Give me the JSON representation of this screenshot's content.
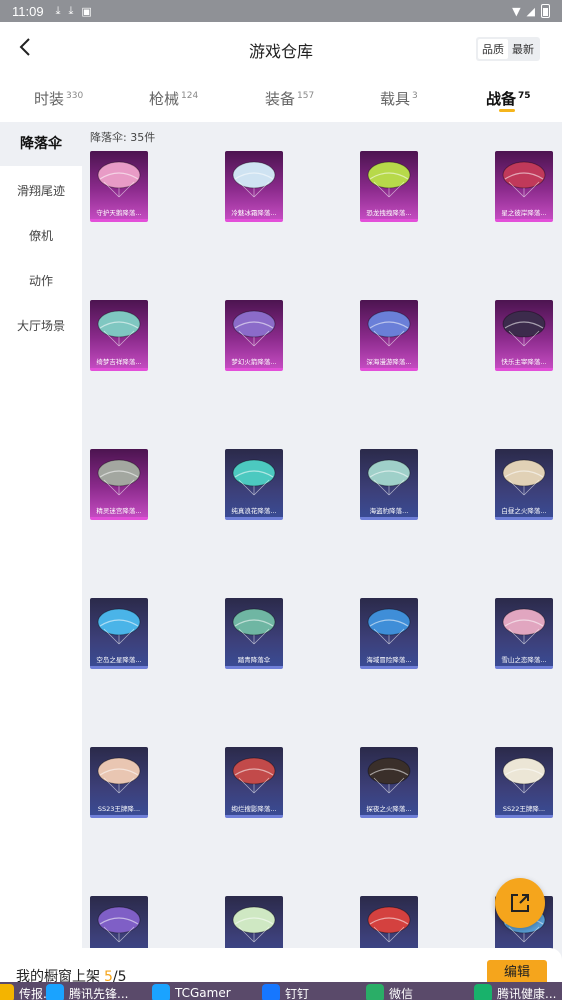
{
  "status": {
    "time": "11:09",
    "icons": [
      "download-icon",
      "download-icon",
      "app-icon"
    ],
    "wifi": "wifi-icon",
    "signal": "signal-icon",
    "battery": "battery-icon"
  },
  "header": {
    "title": "游戏仓库",
    "sort_options": [
      "品质",
      "最新"
    ],
    "sort_active": "品质"
  },
  "tabs": [
    {
      "label": "时装",
      "count": "330"
    },
    {
      "label": "枪械",
      "count": "124"
    },
    {
      "label": "装备",
      "count": "157"
    },
    {
      "label": "载具",
      "count": "3"
    },
    {
      "label": "战备",
      "count": "75"
    }
  ],
  "active_tab": "战备",
  "sidebar": [
    "降落伞",
    "滑翔尾迹",
    "僚机",
    "动作",
    "大厅场景"
  ],
  "sidebar_active": "降落伞",
  "count_label": "降落伞: 35件",
  "items": [
    {
      "name": "守护天鹅降落...",
      "rarity": "purple",
      "color": "#e89bc6"
    },
    {
      "name": "冷魅冰霜降落...",
      "rarity": "purple",
      "color": "#cfe3f2"
    },
    {
      "name": "恐龙拽拽降落...",
      "rarity": "purple",
      "color": "#b7d94a"
    },
    {
      "name": "星之彼岸降落...",
      "rarity": "purple",
      "color": "#c0395a"
    },
    {
      "name": "绮梦吉祥降落...",
      "rarity": "purple",
      "color": "#7fc7c1"
    },
    {
      "name": "梦幻火箭降落...",
      "rarity": "purple",
      "color": "#8b6bc9"
    },
    {
      "name": "深海漫游降落...",
      "rarity": "purple",
      "color": "#6a7fd8"
    },
    {
      "name": "快乐主宰降落...",
      "rarity": "purple",
      "color": "#3c2b4c"
    },
    {
      "name": "精灵迷宫降落...",
      "rarity": "purple",
      "color": "#a3a7a0"
    },
    {
      "name": "纯真浪花降落...",
      "rarity": "blue",
      "color": "#4cc9c0"
    },
    {
      "name": "海盗豹降落...",
      "rarity": "blue",
      "color": "#9fd0c9"
    },
    {
      "name": "白昼之火降落...",
      "rarity": "blue",
      "color": "#e1d1b6"
    },
    {
      "name": "空岛之星降落...",
      "rarity": "blue",
      "color": "#4ab4e8"
    },
    {
      "name": "踏青降落伞",
      "rarity": "blue",
      "color": "#6fb6a3"
    },
    {
      "name": "海域冒险降落...",
      "rarity": "blue",
      "color": "#3f8ed8"
    },
    {
      "name": "雪山之恋降落...",
      "rarity": "blue",
      "color": "#e1a6c0"
    },
    {
      "name": "SS23王牌降...",
      "rarity": "blue",
      "color": "#e9c6b2"
    },
    {
      "name": "绚烂搜影降落...",
      "rarity": "blue",
      "color": "#c24a4a"
    },
    {
      "name": "探夜之火降落...",
      "rarity": "blue",
      "color": "#3a2f2a"
    },
    {
      "name": "SS22王牌降...",
      "rarity": "blue",
      "color": "#ece6d6"
    },
    {
      "name": "",
      "rarity": "blue",
      "color": "#7f5fc6"
    },
    {
      "name": "",
      "rarity": "blue",
      "color": "#cfe8c3"
    },
    {
      "name": "",
      "rarity": "blue",
      "color": "#d4413f"
    },
    {
      "name": "",
      "rarity": "blue",
      "color": "#5aa0d8"
    }
  ],
  "fab_icon": "share-icon",
  "bottom": {
    "label": "我的橱窗上架",
    "current": "5",
    "total": "/5",
    "edit": "编辑"
  },
  "taskbar": [
    {
      "label": "传报...",
      "color": "#f4b400"
    },
    {
      "label": "腾讯先锋...",
      "color": "#1aa3ff"
    },
    {
      "label": "TCGamer",
      "color": "#1aa3ff"
    },
    {
      "label": "钉钉",
      "color": "#1677ff"
    },
    {
      "label": "微信",
      "color": "#2aae67"
    },
    {
      "label": "腾讯健康...",
      "color": "#18b26b"
    }
  ]
}
